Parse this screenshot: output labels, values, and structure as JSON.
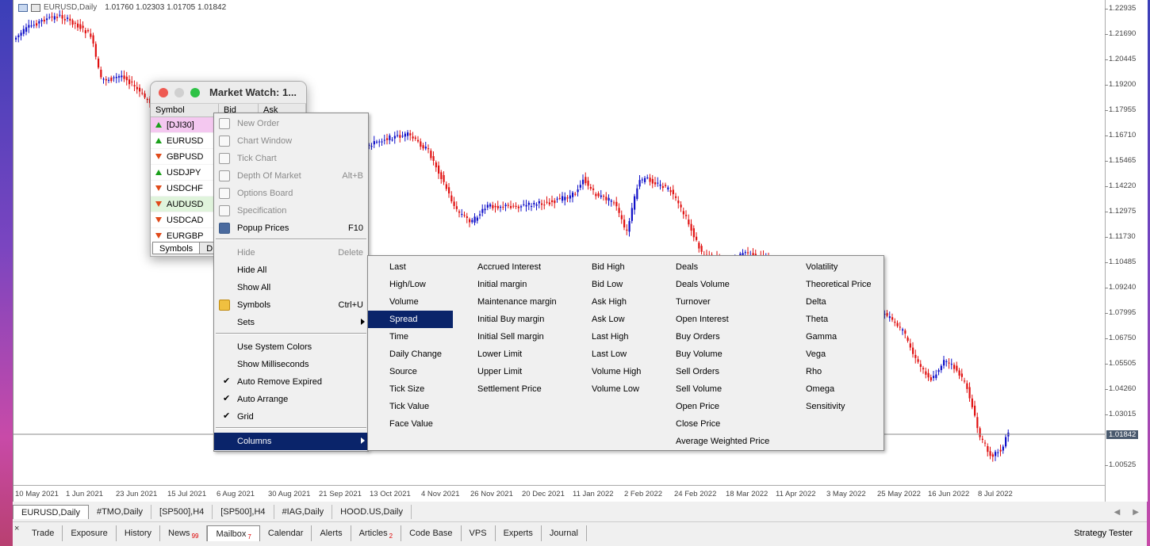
{
  "chart": {
    "title_symbol": "EURUSD,Daily",
    "ohlc": "1.01760 1.02303 1.01705 1.01842",
    "current_price": "1.01842",
    "y_ticks": [
      "1.22935",
      "1.21690",
      "1.20445",
      "1.19200",
      "1.17955",
      "1.16710",
      "1.15465",
      "1.14220",
      "1.12975",
      "1.11730",
      "1.10485",
      "1.09240",
      "1.07995",
      "1.06750",
      "1.05505",
      "1.04260",
      "1.03015",
      "1.00525"
    ],
    "x_ticks": [
      "10 May 2021",
      "1 Jun 2021",
      "23 Jun 2021",
      "15 Jul 2021",
      "6 Aug 2021",
      "30 Aug 2021",
      "21 Sep 2021",
      "13 Oct 2021",
      "4 Nov 2021",
      "26 Nov 2021",
      "20 Dec 2021",
      "11 Jan 2022",
      "2 Feb 2022",
      "24 Feb 2022",
      "18 Mar 2022",
      "11 Apr 2022",
      "3 May 2022",
      "25 May 2022",
      "16 Jun 2022",
      "8 Jul 2022"
    ],
    "colors": {
      "bull": "#1010c8",
      "bear": "#e01010",
      "grid_line": "#8a8a8a"
    }
  },
  "chart_tabs": [
    "EURUSD,Daily",
    "#TMO,Daily",
    "[SP500],H4",
    "[SP500],H4",
    "#IAG,Daily",
    "HOOD.US,Daily"
  ],
  "toolbox": {
    "close": "×",
    "tabs": [
      {
        "label": "Trade",
        "badge": ""
      },
      {
        "label": "Exposure",
        "badge": ""
      },
      {
        "label": "History",
        "badge": ""
      },
      {
        "label": "News",
        "badge": "99"
      },
      {
        "label": "Mailbox",
        "badge": "7"
      },
      {
        "label": "Calendar",
        "badge": ""
      },
      {
        "label": "Alerts",
        "badge": ""
      },
      {
        "label": "Articles",
        "badge": "2"
      },
      {
        "label": "Code Base",
        "badge": ""
      },
      {
        "label": "VPS",
        "badge": ""
      },
      {
        "label": "Experts",
        "badge": ""
      },
      {
        "label": "Journal",
        "badge": ""
      }
    ],
    "strategy_tester": "Strategy Tester"
  },
  "market_watch": {
    "title": "Market Watch: 1...",
    "columns": [
      "Symbol",
      "Bid",
      "Ask"
    ],
    "rows": [
      {
        "symbol": "[DJI30]",
        "dir": "up"
      },
      {
        "symbol": "EURUSD",
        "dir": "up"
      },
      {
        "symbol": "GBPUSD",
        "dir": "down"
      },
      {
        "symbol": "USDJPY",
        "dir": "up"
      },
      {
        "symbol": "USDCHF",
        "dir": "down"
      },
      {
        "symbol": "AUDUSD",
        "dir": "down"
      },
      {
        "symbol": "USDCAD",
        "dir": "down"
      },
      {
        "symbol": "EURGBP",
        "dir": "down"
      }
    ],
    "tabs": [
      "Symbols",
      "D"
    ]
  },
  "context_menu": {
    "items": [
      {
        "label": "New Order",
        "key": "",
        "disabled": true
      },
      {
        "label": "Chart Window",
        "key": "",
        "disabled": true
      },
      {
        "label": "Tick Chart",
        "key": "",
        "disabled": true
      },
      {
        "label": "Depth Of Market",
        "key": "Alt+B",
        "disabled": true
      },
      {
        "label": "Options Board",
        "key": "",
        "disabled": true
      },
      {
        "label": "Specification",
        "key": "",
        "disabled": true
      },
      {
        "label": "Popup Prices",
        "key": "F10",
        "disabled": false
      },
      {
        "label": "Hide",
        "key": "Delete",
        "disabled": true
      },
      {
        "label": "Hide All",
        "key": "",
        "disabled": false
      },
      {
        "label": "Show All",
        "key": "",
        "disabled": false
      },
      {
        "label": "Symbols",
        "key": "Ctrl+U",
        "disabled": false
      },
      {
        "label": "Sets",
        "key": "",
        "disabled": false
      },
      {
        "label": "Use System Colors",
        "key": "",
        "disabled": false
      },
      {
        "label": "Show Milliseconds",
        "key": "",
        "disabled": false
      },
      {
        "label": "Auto Remove Expired",
        "key": "",
        "disabled": false
      },
      {
        "label": "Auto Arrange",
        "key": "",
        "disabled": false
      },
      {
        "label": "Grid",
        "key": "",
        "disabled": false
      },
      {
        "label": "Columns",
        "key": "",
        "disabled": false
      }
    ],
    "check_mark": "✔"
  },
  "columns_submenu": {
    "col1": [
      "Last",
      "High/Low",
      "Volume",
      "Spread",
      "Time",
      "Daily Change",
      "Source",
      "Tick Size",
      "Tick Value",
      "Face Value"
    ],
    "col2": [
      "Accrued Interest",
      "Initial margin",
      "Maintenance margin",
      "Initial Buy margin",
      "Initial Sell margin",
      "Lower Limit",
      "Upper Limit",
      "Settlement Price"
    ],
    "col3": [
      "Bid High",
      "Bid Low",
      "Ask High",
      "Ask Low",
      "Last High",
      "Last Low",
      "Volume High",
      "Volume Low"
    ],
    "col4": [
      "Deals",
      "Deals Volume",
      "Turnover",
      "Open Interest",
      "Buy Orders",
      "Buy Volume",
      "Sell Orders",
      "Sell Volume",
      "Open Price",
      "Close Price",
      "Average Weighted Price"
    ],
    "col5": [
      "Volatility",
      "Theoretical Price",
      "Delta",
      "Theta",
      "Gamma",
      "Vega",
      "Rho",
      "Omega",
      "Sensitivity"
    ],
    "selected": "Spread"
  }
}
